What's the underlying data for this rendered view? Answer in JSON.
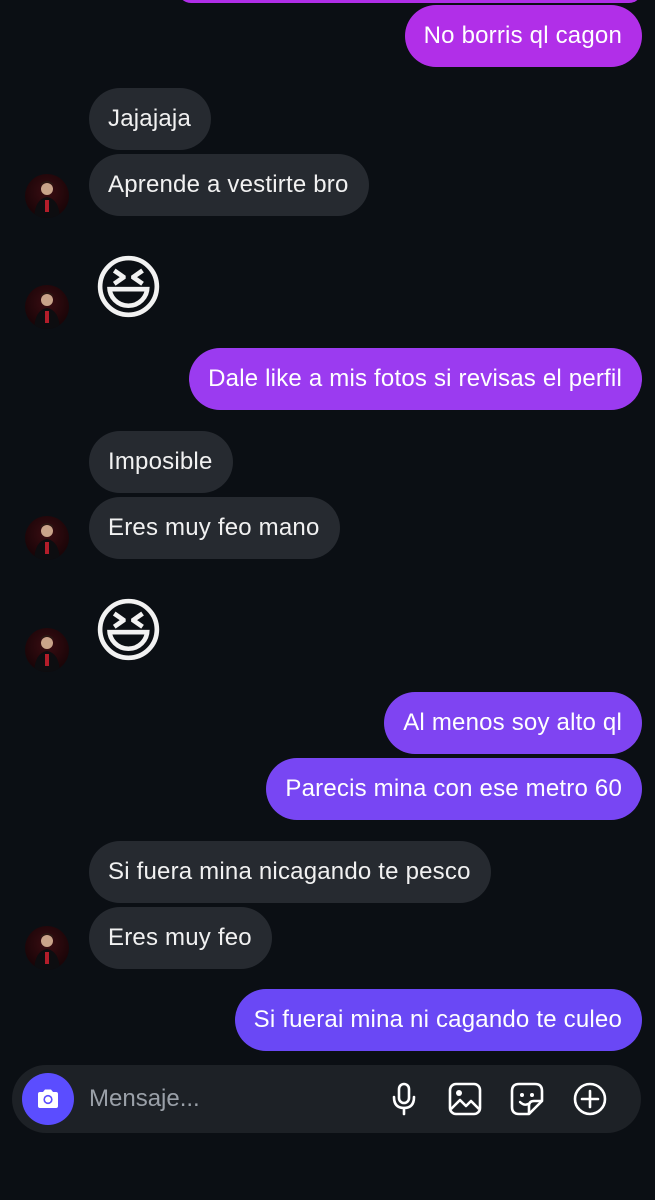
{
  "messages": [
    {
      "side": "out",
      "text": "No borris ql cagon"
    },
    {
      "side": "in",
      "text": "Jajajaja"
    },
    {
      "side": "in",
      "text": "Aprende a vestirte bro"
    },
    {
      "side": "in",
      "emoji": "😆"
    },
    {
      "side": "out",
      "text": "Dale like a mis fotos si revisas el perfil"
    },
    {
      "side": "in",
      "text": "Imposible"
    },
    {
      "side": "in",
      "text": "Eres muy feo mano"
    },
    {
      "side": "in",
      "emoji": "😆"
    },
    {
      "side": "out",
      "text": "Al menos soy alto ql"
    },
    {
      "side": "out",
      "text": "Parecis mina con ese metro 60"
    },
    {
      "side": "in",
      "text": "Si fuera mina nicagando te pesco"
    },
    {
      "side": "in",
      "text": "Eres muy feo"
    },
    {
      "side": "out",
      "text": "Si fuerai mina ni cagando te culeo"
    }
  ],
  "composer": {
    "placeholder": "Mensaje...",
    "icons": [
      "camera-icon",
      "microphone-icon",
      "image-icon",
      "sticker-icon",
      "plus-icon"
    ]
  },
  "colors": {
    "background": "#0b0f14",
    "incoming_bubble": "#262a30",
    "outgoing_gradient_top": "#b02ee8",
    "outgoing_gradient_bottom": "#6a48f5",
    "camera_button": "#5b4dff"
  }
}
